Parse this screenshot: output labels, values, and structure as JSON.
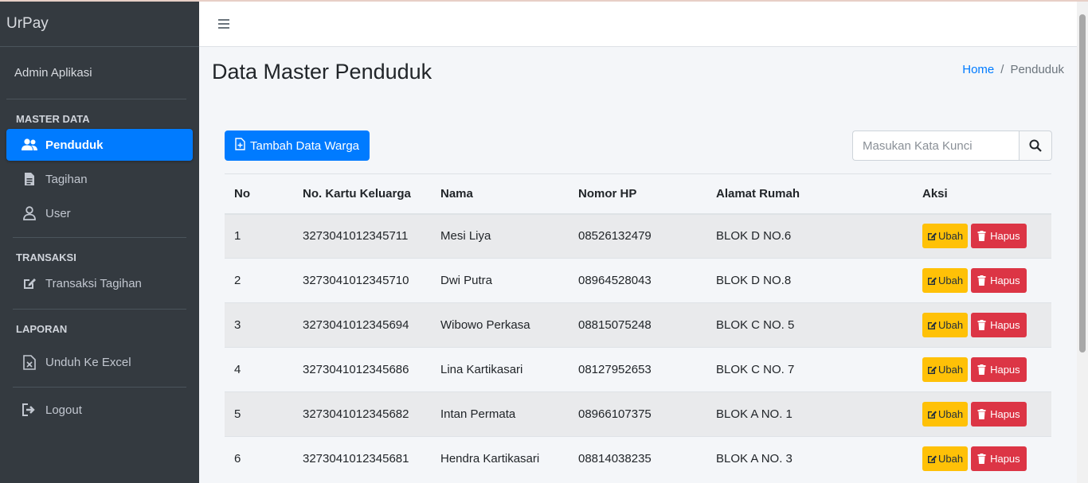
{
  "app": {
    "brand": "UrPay"
  },
  "sidebar": {
    "user": "Admin Aplikasi",
    "sections": [
      {
        "header": "MASTER DATA",
        "items": [
          {
            "label": "Penduduk",
            "icon": "users-icon",
            "active": true
          },
          {
            "label": "Tagihan",
            "icon": "file-invoice-icon",
            "active": false
          },
          {
            "label": "User",
            "icon": "user-icon",
            "active": false
          }
        ]
      },
      {
        "header": "TRANSAKSI",
        "items": [
          {
            "label": "Transaksi Tagihan",
            "icon": "edit-icon",
            "active": false
          }
        ]
      },
      {
        "header": "LAPORAN",
        "items": [
          {
            "label": "Unduh Ke Excel",
            "icon": "file-excel-icon",
            "active": false
          }
        ]
      }
    ],
    "logout": "Logout"
  },
  "page": {
    "title": "Data Master Penduduk",
    "breadcrumb": {
      "home": "Home",
      "separator": "/",
      "current": "Penduduk"
    }
  },
  "toolbar": {
    "add_label": "Tambah Data Warga",
    "search_placeholder": "Masukan Kata Kunci"
  },
  "table": {
    "columns": [
      "No",
      "No. Kartu Keluarga",
      "Nama",
      "Nomor HP",
      "Alamat Rumah",
      "Aksi"
    ],
    "edit_label": "Ubah",
    "delete_label": "Hapus",
    "rows": [
      {
        "no": "1",
        "kk": "3273041012345711",
        "nama": "Mesi Liya",
        "hp": "08526132479",
        "alamat": "BLOK D NO.6"
      },
      {
        "no": "2",
        "kk": "3273041012345710",
        "nama": "Dwi Putra",
        "hp": "08964528043",
        "alamat": "BLOK D NO.8"
      },
      {
        "no": "3",
        "kk": "3273041012345694",
        "nama": "Wibowo Perkasa",
        "hp": "08815075248",
        "alamat": "BLOK C NO. 5"
      },
      {
        "no": "4",
        "kk": "3273041012345686",
        "nama": "Lina Kartikasari",
        "hp": "08127952653",
        "alamat": "BLOK C NO. 7"
      },
      {
        "no": "5",
        "kk": "3273041012345682",
        "nama": "Intan Permata",
        "hp": "08966107375",
        "alamat": "BLOK A NO. 1"
      },
      {
        "no": "6",
        "kk": "3273041012345681",
        "nama": "Hendra Kartikasari",
        "hp": "08814038235",
        "alamat": "BLOK A NO. 3"
      }
    ]
  },
  "colors": {
    "sidebar": "#343a40",
    "primary": "#007bff",
    "warning": "#ffc107",
    "danger": "#dc3545"
  }
}
